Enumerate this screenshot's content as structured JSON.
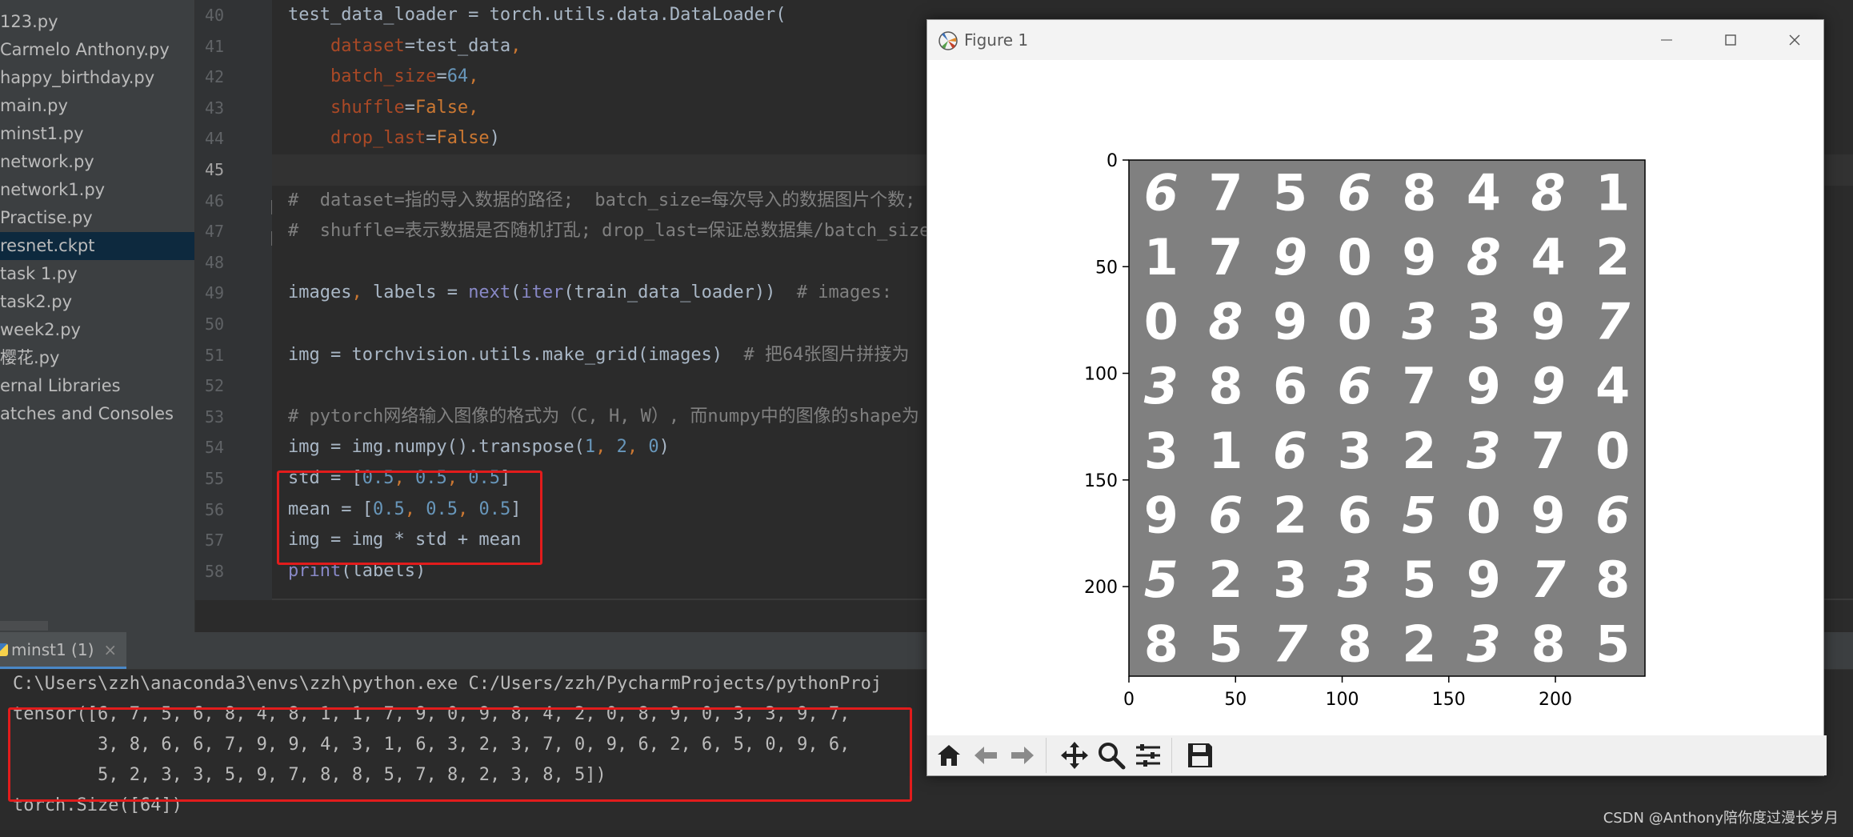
{
  "project_tree": {
    "items": [
      {
        "label": "123.py",
        "selected": false
      },
      {
        "label": "Carmelo Anthony.py",
        "selected": false
      },
      {
        "label": "happy_birthday.py",
        "selected": false
      },
      {
        "label": "main.py",
        "selected": false
      },
      {
        "label": "minst1.py",
        "selected": false
      },
      {
        "label": "network.py",
        "selected": false
      },
      {
        "label": "network1.py",
        "selected": false
      },
      {
        "label": "Practise.py",
        "selected": false
      },
      {
        "label": "resnet.ckpt",
        "selected": true
      },
      {
        "label": "task 1.py",
        "selected": false
      },
      {
        "label": "task2.py",
        "selected": false
      },
      {
        "label": "week2.py",
        "selected": false
      },
      {
        "label": "樱花.py",
        "selected": false
      },
      {
        "label": "ernal Libraries",
        "selected": false
      },
      {
        "label": "atches and Consoles",
        "selected": false
      }
    ]
  },
  "editor": {
    "line_numbers": [
      "40",
      "41",
      "42",
      "43",
      "44",
      "45",
      "46",
      "47",
      "48",
      "49",
      "50",
      "51",
      "52",
      "53",
      "54",
      "55",
      "56",
      "57",
      "58"
    ],
    "current_line": "45"
  },
  "run_panel": {
    "tab_label": "minst1 (1)",
    "close_glyph": "×",
    "console_lines": [
      "C:\\Users\\zzh\\anaconda3\\envs\\zzh\\python.exe C:/Users/zzh/PycharmProjects/pythonProj",
      "tensor([6, 7, 5, 6, 8, 4, 8, 1, 1, 7, 9, 0, 9, 8, 4, 2, 0, 8, 9, 0, 3, 3, 9, 7,",
      "        3, 8, 6, 6, 7, 9, 9, 4, 3, 1, 6, 3, 2, 3, 7, 0, 9, 6, 2, 6, 5, 0, 9, 6,",
      "        5, 2, 3, 3, 5, 9, 7, 8, 8, 5, 7, 8, 2, 3, 8, 5])",
      "torch.Size([64])"
    ]
  },
  "figure_window": {
    "title": "Figure 1",
    "toolbar": [
      "home-icon",
      "back-arrow-icon",
      "forward-arrow-icon",
      "pan-move-icon",
      "zoom-magnifier-icon",
      "configure-subplots-icon",
      "save-floppy-icon"
    ]
  },
  "chart_data": {
    "type": "heatmap",
    "description_source": "matplotlib imshow of an 8x8 grid of MNIST digits",
    "x_ticks": [
      0,
      50,
      100,
      150,
      200
    ],
    "y_ticks": [
      0,
      50,
      100,
      150,
      200
    ],
    "xlim": [
      0,
      242
    ],
    "ylim": [
      242,
      0
    ],
    "grid_rows": [
      [
        "6",
        "7",
        "5",
        "6",
        "8",
        "4",
        "8",
        "1"
      ],
      [
        "1",
        "7",
        "9",
        "0",
        "9",
        "8",
        "4",
        "2"
      ],
      [
        "0",
        "8",
        "9",
        "0",
        "3",
        "3",
        "9",
        "7"
      ],
      [
        "3",
        "8",
        "6",
        "6",
        "7",
        "9",
        "9",
        "4"
      ],
      [
        "3",
        "1",
        "6",
        "3",
        "2",
        "3",
        "7",
        "0"
      ],
      [
        "9",
        "6",
        "2",
        "6",
        "5",
        "0",
        "9",
        "6"
      ],
      [
        "5",
        "2",
        "3",
        "3",
        "5",
        "9",
        "7",
        "8"
      ],
      [
        "8",
        "5",
        "7",
        "8",
        "2",
        "3",
        "8",
        "5"
      ]
    ],
    "colors": {
      "background": "#808080",
      "digit": "#ffffff"
    }
  },
  "watermark": "CSDN @Anthony陪你度过漫长岁月",
  "colors": {
    "highlight_box": "#e21c1c",
    "editor_bg": "#2b2b2b",
    "sidebar_bg": "#3c3f41"
  }
}
